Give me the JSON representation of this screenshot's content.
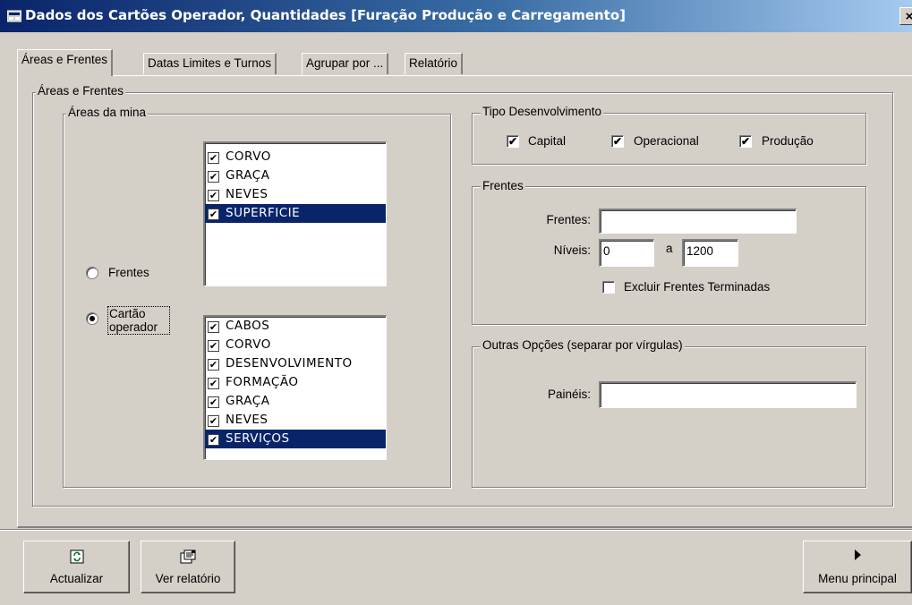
{
  "window": {
    "title": "Dados dos Cartões Operador, Quantidades [Furação Produção e Carregamento]",
    "close_glyph": "×"
  },
  "tabs": [
    {
      "label": "Áreas e Frentes",
      "active": true
    },
    {
      "label": "Datas Limites e Turnos",
      "active": false
    },
    {
      "label": "Agrupar por ...",
      "active": false
    },
    {
      "label": "Relatório",
      "active": false
    }
  ],
  "areas_frentes": {
    "legend": "Áreas e Frentes",
    "areas_mina": {
      "legend": "Áreas da mina",
      "list_top": [
        {
          "label": "CORVO",
          "checked": true,
          "selected": false
        },
        {
          "label": "GRAÇA",
          "checked": true,
          "selected": false
        },
        {
          "label": "NEVES",
          "checked": true,
          "selected": false
        },
        {
          "label": "SUPERFICIE",
          "checked": true,
          "selected": true
        }
      ],
      "radio_frentes": {
        "label": "Frentes",
        "checked": false
      },
      "radio_cartao": {
        "label": "Cartão operador",
        "checked": true
      },
      "list_bottom": [
        {
          "label": "CABOS",
          "checked": true,
          "selected": false
        },
        {
          "label": "CORVO",
          "checked": true,
          "selected": false
        },
        {
          "label": "DESENVOLVIMENTO",
          "checked": true,
          "selected": false
        },
        {
          "label": "FORMAÇÃO",
          "checked": true,
          "selected": false
        },
        {
          "label": "GRAÇA",
          "checked": true,
          "selected": false
        },
        {
          "label": "NEVES",
          "checked": true,
          "selected": false
        },
        {
          "label": "SERVIÇOS",
          "checked": true,
          "selected": true
        }
      ]
    },
    "tipo_desenvolvimento": {
      "legend": "Tipo Desenvolvimento",
      "capital": {
        "label": "Capital",
        "checked": true
      },
      "operacional": {
        "label": "Operacional",
        "checked": true
      },
      "producao": {
        "label": "Produção",
        "checked": true
      }
    },
    "frentes": {
      "legend": "Frentes",
      "frentes_label": "Frentes:",
      "frentes_value": "",
      "niveis_label": "Níveis:",
      "niveis_from": "0",
      "niveis_sep": "a",
      "niveis_to": "1200",
      "excluir": {
        "label": "Excluir Frentes Terminadas",
        "checked": false
      }
    },
    "outras_opcoes": {
      "legend": "Outras Opções (separar por vírgulas)",
      "paineis_label": "Painéis:",
      "paineis_value": ""
    }
  },
  "buttons": {
    "actualizar": {
      "label": "Actualizar",
      "icon": "refresh-icon"
    },
    "ver_relatorio": {
      "label": "Ver relatório",
      "icon": "report-icon"
    },
    "menu_principal": {
      "label": "Menu principal",
      "icon": "play-arrow-icon"
    }
  },
  "colors": {
    "face": "#d4d0c8",
    "title_dark": "#0a246a",
    "title_light": "#a6caf0",
    "selection": "#0a246a"
  },
  "check_glyph": "✔"
}
